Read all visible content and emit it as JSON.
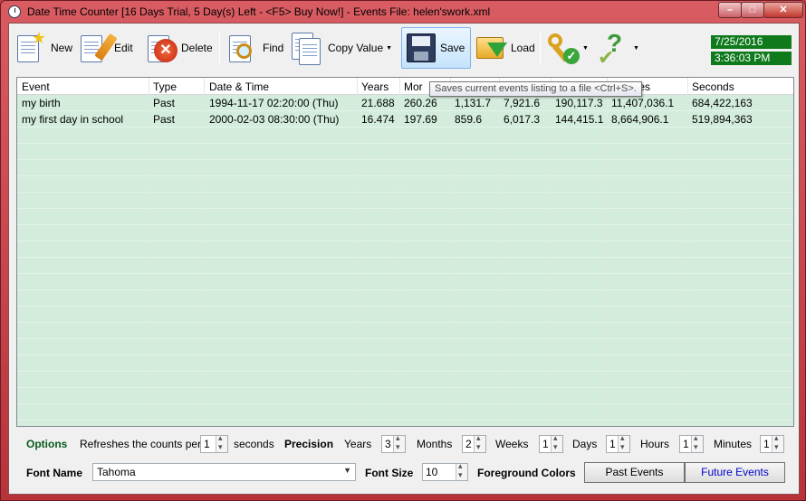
{
  "window": {
    "title": "Date Time Counter [16 Days Trial, 5 Day(s) Left  - <F5> Buy Now!] - Events File: helen'swork.xml",
    "minimize": "–",
    "maximize": "□",
    "close": "✕"
  },
  "toolbar": {
    "new_label": "New",
    "edit_label": "Edit",
    "delete_label": "Delete",
    "find_label": "Find",
    "copy_value_label": "Copy Value",
    "save_label": "Save",
    "load_label": "Load",
    "date": "7/25/2016",
    "time": "3:36:03 PM"
  },
  "tooltip": "Saves current events listing to a file <Ctrl+S>.",
  "grid": {
    "columns": [
      "Event",
      "Type",
      "Date & Time",
      "Years",
      "Mor",
      "",
      "",
      "",
      "inutes",
      "Seconds"
    ],
    "rows": [
      [
        "my birth",
        "Past",
        "1994-11-17 02:20:00 (Thu)",
        "21.688",
        "260.26",
        "1,131.7",
        "7,921.6",
        "190,117.3",
        "11,407,036.1",
        "684,422,163"
      ],
      [
        "my first day in school",
        "Past",
        "2000-02-03 08:30:00 (Thu)",
        "16.474",
        "197.69",
        "859.6",
        "6,017.3",
        "144,415.1",
        "8,664,906.1",
        "519,894,363"
      ]
    ]
  },
  "options": {
    "options_label": "Options",
    "refresh_label": "Refreshes the counts per",
    "refresh_value": "1",
    "seconds_label": "seconds",
    "precision_label": "Precision",
    "years_label": "Years",
    "years_value": "3",
    "months_label": "Months",
    "months_value": "2",
    "weeks_label": "Weeks",
    "weeks_value": "1",
    "days_label": "Days",
    "days_value": "1",
    "hours_label": "Hours",
    "hours_value": "1",
    "minutes_label": "Minutes",
    "minutes_value": "1",
    "font_name_label": "Font Name",
    "font_name_value": "Tahoma",
    "font_size_label": "Font Size",
    "font_size_value": "10",
    "foreground_colors_label": "Foreground Colors",
    "past_events_label": "Past Events",
    "future_events_label": "Future Events"
  },
  "colors": {
    "clock_bg": "#0e7a1b",
    "grid_bg": "#d3ecdc",
    "future_events_text": "#0000cc",
    "frame": "#c8424a"
  }
}
